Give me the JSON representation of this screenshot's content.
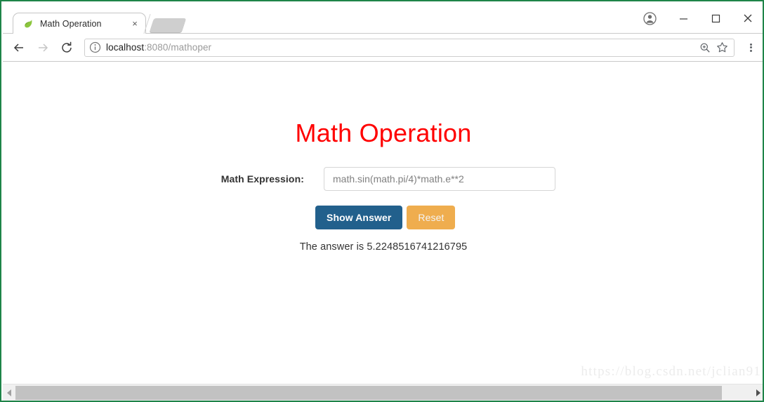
{
  "browser": {
    "tab": {
      "title": "Math Operation",
      "favicon_name": "spring-leaf-favicon",
      "close_label": "×"
    },
    "new_tab_name": "new-tab-button",
    "window_controls": {
      "profile": "profile-icon",
      "minimize": "−",
      "maximize": "□",
      "close": "✕"
    },
    "nav": {
      "back": "back-arrow-icon",
      "forward": "forward-arrow-icon",
      "reload": "reload-icon"
    },
    "omnibox": {
      "security_icon": "info-circle-icon",
      "url_host": "localhost",
      "url_rest": ":8080/mathoper",
      "zoom_icon": "zoom-in-icon",
      "bookmark_icon": "star-icon"
    },
    "menu_icon": "three-dot-menu-icon"
  },
  "page": {
    "title": "Math Operation",
    "title_color": "#ff0000",
    "form": {
      "label": "Math Expression:",
      "expression_value": "math.sin(math.pi/4)*math.e**2",
      "expression_placeholder": "math.sin(math.pi/4)*math.e**2"
    },
    "buttons": {
      "submit_label": "Show Answer",
      "submit_color": "#22608c",
      "reset_label": "Reset",
      "reset_color": "#efad4e"
    },
    "answer_text": "The answer is 5.2248516741216795",
    "answer_value": "5.2248516741216795",
    "watermark": "https://blog.csdn.net/jclian91"
  },
  "scrollbar": {
    "left_arrow": "scroll-left-arrow",
    "right_arrow": "scroll-right-arrow"
  }
}
